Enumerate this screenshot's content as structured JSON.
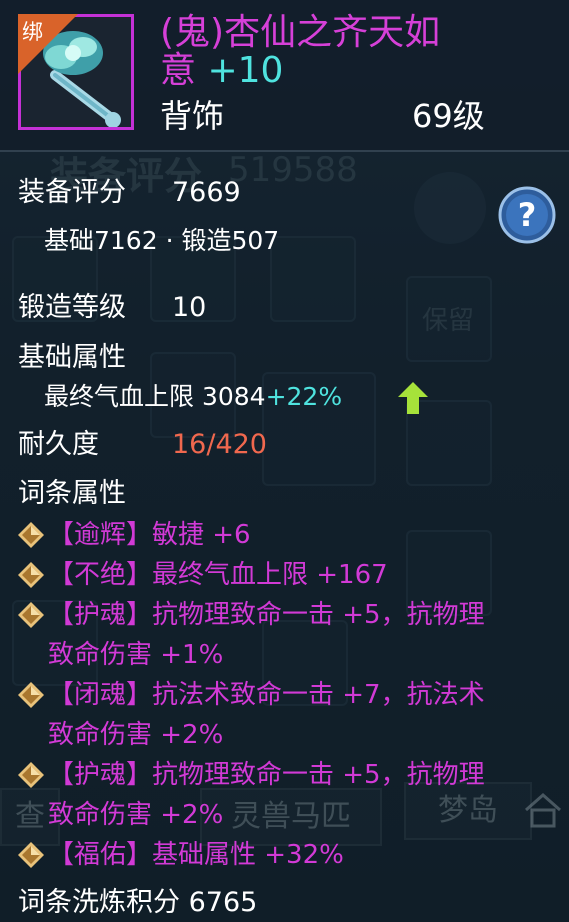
{
  "item": {
    "bind_badge": "绑",
    "name_line1": "(鬼)杏仙之齐天如",
    "name_line2": "意",
    "enhance": "+10",
    "slot": "背饰",
    "level": "69级",
    "border_color": "#c431d6"
  },
  "background": {
    "score_label": "装备评分",
    "score_value": "519588",
    "reserve_label": "保留",
    "tab_query": "查",
    "tab_mount": "灵兽马匹",
    "tab_dream": "梦岛",
    "help_icon": "question-icon",
    "clothes_icon": "shirt-icon",
    "home_icon": "house-icon"
  },
  "stats": {
    "score_label": "装备评分",
    "score_value": "7669",
    "score_breakdown": "基础7162 · 锻造507",
    "forge_label": "锻造等级",
    "forge_value": "10",
    "base_label": "基础属性",
    "base_stat": "最终气血上限 3084",
    "base_bonus": "+22%",
    "base_arrow_icon": "up-arrow-icon",
    "durability_label": "耐久度",
    "durability_value": "16/420",
    "affix_label": "词条属性",
    "wash_label": "词条洗炼积分",
    "wash_value": "6765"
  },
  "affixes": [
    {
      "line1": "【逾辉】敏捷 +6",
      "line2": ""
    },
    {
      "line1": "【不绝】最终气血上限 +167",
      "line2": ""
    },
    {
      "line1": "【护魂】抗物理致命一击 +5，抗物理",
      "line2": "致命伤害 +1%"
    },
    {
      "line1": "【闭魂】抗法术致命一击 +7，抗法术",
      "line2": "致命伤害 +2%"
    },
    {
      "line1": "【护魂】抗物理致命一击 +5，抗物理",
      "line2": "致命伤害 +2%"
    },
    {
      "line1": "【福佑】基础属性 +32%",
      "line2": ""
    }
  ],
  "colors": {
    "affix_text": "#d23ad6",
    "title": "#d640d8",
    "bonus": "#4fe3df",
    "durability": "#f0684e",
    "arrow": "#a6e23a",
    "diamond": "#e8c27a"
  }
}
